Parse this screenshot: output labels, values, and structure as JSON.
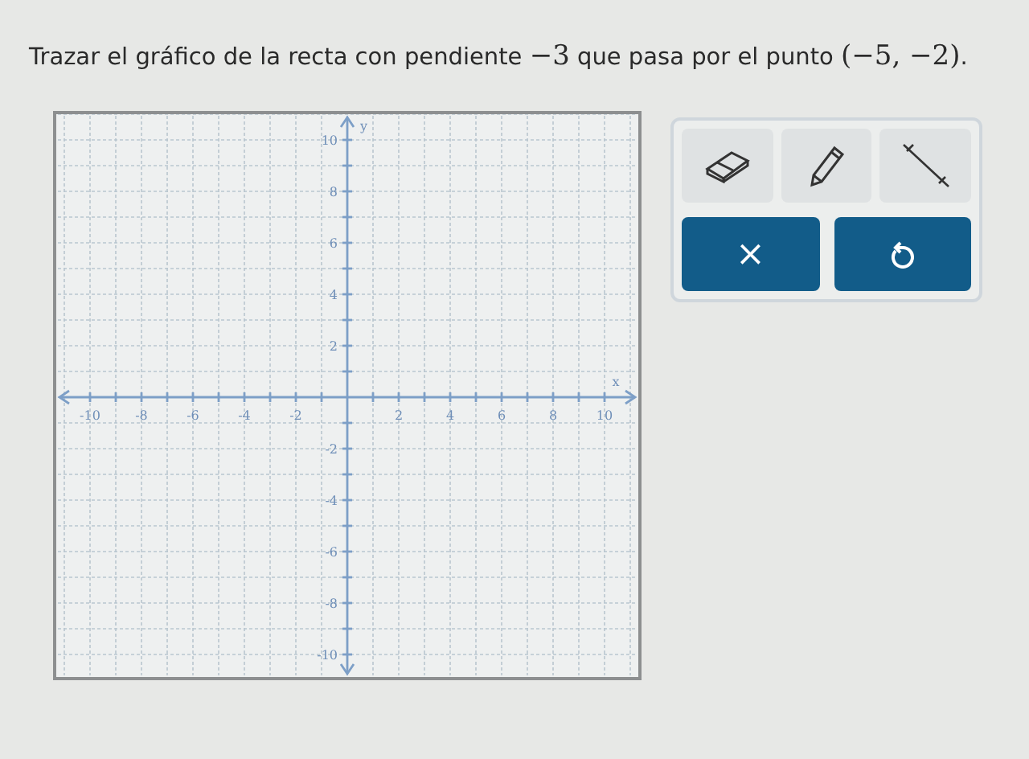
{
  "question": {
    "segments": [
      {
        "kind": "text",
        "text": "Trazar el gráfico de la recta con pendiente "
      },
      {
        "kind": "math",
        "text": "−3"
      },
      {
        "kind": "text",
        "text": " que pasa por el punto "
      },
      {
        "kind": "math",
        "text": "(−5, −2)"
      },
      {
        "kind": "text",
        "text": "."
      }
    ]
  },
  "graph": {
    "x_label": "x",
    "y_label": "y",
    "x_ticks": [
      "-10",
      "-8",
      "-6",
      "-4",
      "-2",
      "2",
      "4",
      "6",
      "8",
      "10"
    ],
    "y_ticks": [
      "10",
      "8",
      "6",
      "4",
      "2",
      "-2",
      "-4",
      "-6",
      "-8",
      "-10"
    ]
  },
  "tools": [
    {
      "kind": "eraser"
    },
    {
      "kind": "pencil"
    },
    {
      "kind": "line"
    }
  ],
  "actions": [
    {
      "kind": "clear",
      "label": "×"
    },
    {
      "kind": "undo"
    }
  ]
}
